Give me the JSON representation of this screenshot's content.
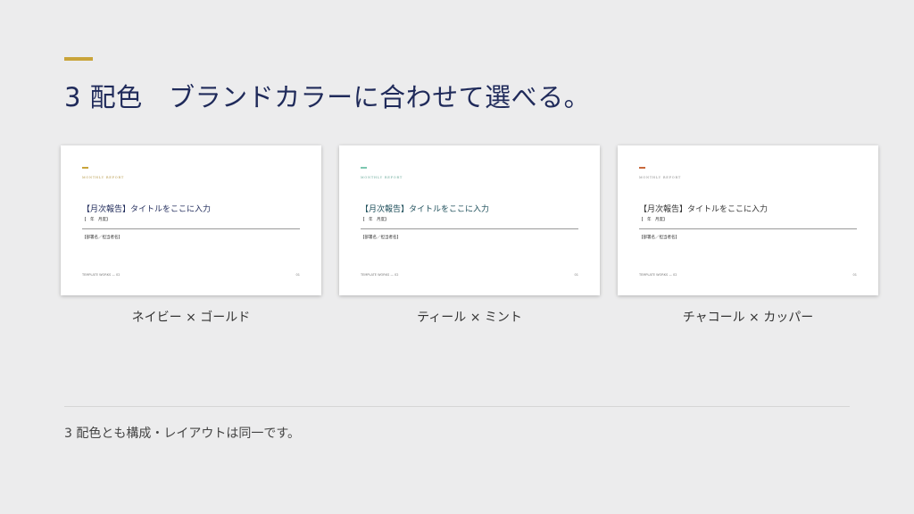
{
  "header": {
    "title": "3 配色　ブランドカラーに合わせて選べる。",
    "accent_color": "#c9a43a"
  },
  "preview": {
    "label": "MONTHLY REPORT",
    "title": "【月次報告】タイトルをここに入力",
    "date": "【　年　月度】",
    "department": "【部署名／担当者名】",
    "footer": "TEMPLATE WORKS — 02",
    "page": "01"
  },
  "variants": [
    {
      "name": "ネイビー × ゴールド",
      "title_color": "#1f2a5a",
      "accent_color": "#c9a43a",
      "label_color": "#b79a4a"
    },
    {
      "name": "ティール × ミント",
      "title_color": "#1d4e5a",
      "accent_color": "#7cc7b0",
      "label_color": "#6aaa9a"
    },
    {
      "name": "チャコール × カッパー",
      "title_color": "#333333",
      "accent_color": "#c8693c",
      "label_color": "#8a8a8a"
    }
  ],
  "footnote": "3 配色とも構成・レイアウトは同一です。"
}
